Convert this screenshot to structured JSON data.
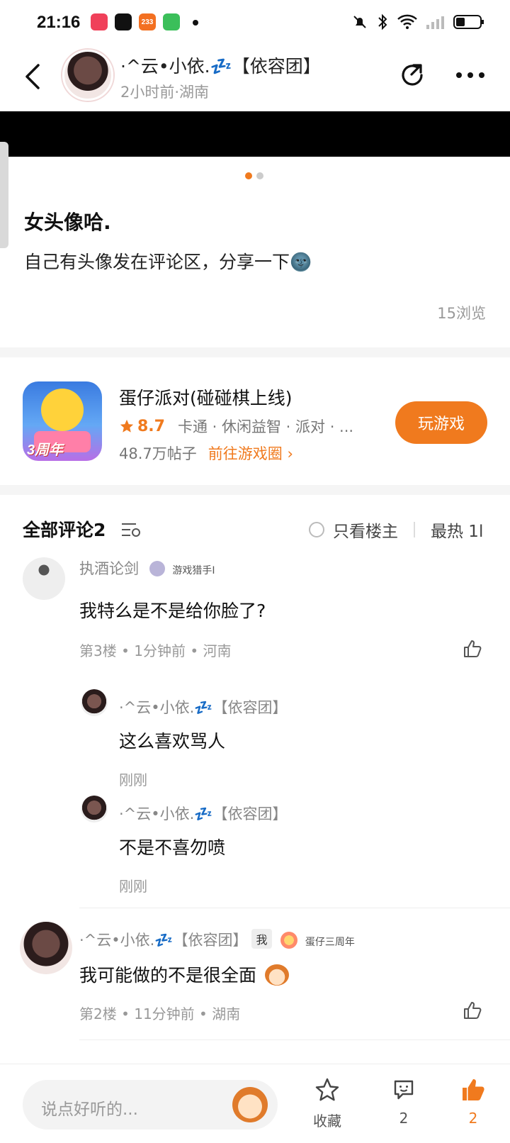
{
  "status_bar": {
    "time": "21:16",
    "app_badge_text": "233"
  },
  "header": {
    "author_name": "·^云•小依.💤【依容团】",
    "post_meta": "2小时前·湖南"
  },
  "post": {
    "title": "女头像哈.",
    "body": "自己有头像发在评论区，分享一下🌚",
    "views": "15浏览"
  },
  "game_card": {
    "name": "蛋仔派对(碰碰棋上线)",
    "score": "8.7",
    "tags": "卡通 · 休闲益智 · 派对 · ...",
    "posts": "48.7万帖子",
    "link": "前往游戏圈 ›",
    "play_label": "玩游戏",
    "icon_label": "3周年"
  },
  "comments_header": {
    "title": "全部评论2",
    "only_op": "只看楼主",
    "sort": "最热 1l"
  },
  "comments": [
    {
      "user": "执酒论剑",
      "badge": "游戏猎手I",
      "text": "我特么是不是给你脸了?",
      "meta": "第3楼 • 1分钟前 • 河南",
      "replies": [
        {
          "user": "·^云•小依.💤【依容团】",
          "text": "这么喜欢骂人",
          "time": "刚刚"
        },
        {
          "user": "·^云•小依.💤【依容团】",
          "text": "不是不喜勿喷",
          "time": "刚刚"
        }
      ]
    },
    {
      "user": "·^云•小依.💤【依容团】",
      "me_badge": "我",
      "badge": "蛋仔三周年",
      "text": "我可能做的不是很全面",
      "meta": "第2楼 • 11分钟前 • 湖南"
    }
  ],
  "bottom_bar": {
    "placeholder": "说点好听的...",
    "favorite_label": "收藏",
    "comment_count": "2",
    "like_count": "2"
  },
  "colors": {
    "accent": "#f07a1e",
    "separator": "#f5f5f5"
  }
}
